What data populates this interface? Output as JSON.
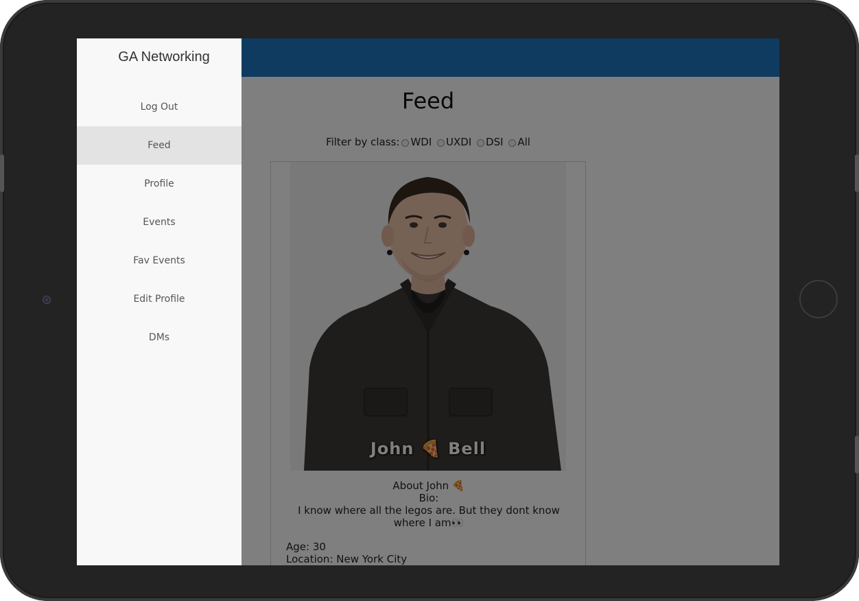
{
  "app": {
    "title": "GA Networking"
  },
  "sidebar": {
    "items": [
      {
        "label": "Log Out"
      },
      {
        "label": "Feed"
      },
      {
        "label": "Profile"
      },
      {
        "label": "Events"
      },
      {
        "label": "Fav Events"
      },
      {
        "label": "Edit Profile"
      },
      {
        "label": "DMs"
      }
    ],
    "active": "Feed"
  },
  "feed": {
    "title": "Feed",
    "filter": {
      "label": "Filter by class:",
      "options": [
        "WDI",
        "UXDI",
        "DSI",
        "All"
      ]
    }
  },
  "profile_card": {
    "name_overlay": "John 🍕 Bell",
    "about": "About John 🍕",
    "bio_label": "Bio:",
    "bio": "I know where all the legos are. But they dont know where I am👀",
    "age": "Age: 30",
    "location": "Location: New York City"
  },
  "colors": {
    "topbar": "#1f77c0",
    "sidebar_bg": "#f8f8f8",
    "active_item": "#e3e3e3",
    "device_frame": "#232323"
  }
}
